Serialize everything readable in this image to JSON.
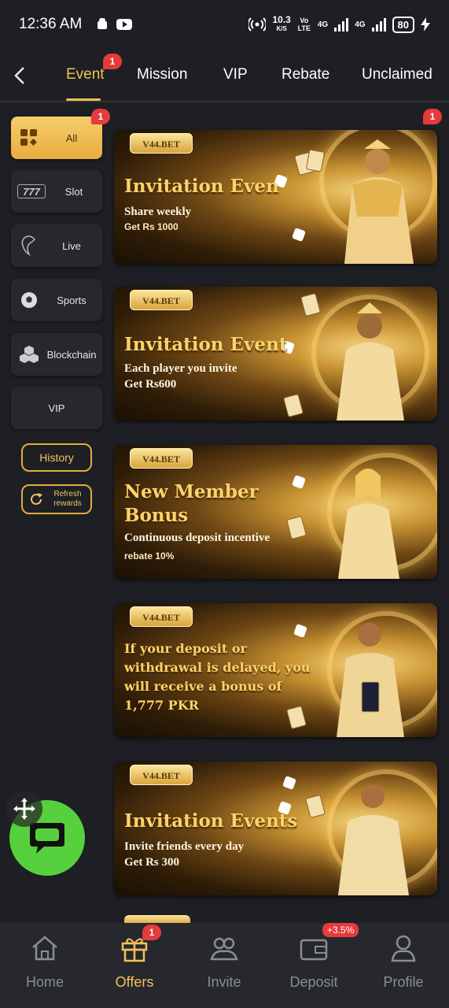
{
  "status_bar": {
    "time": "12:36 AM",
    "speed_value": "10.3",
    "speed_unit": "K/S",
    "volte": "Vo LTE",
    "net1": "4G",
    "net2": "4G",
    "battery": "80"
  },
  "topnav": {
    "tabs": [
      {
        "label": "Event",
        "badge": "1"
      },
      {
        "label": "Mission"
      },
      {
        "label": "VIP"
      },
      {
        "label": "Rebate"
      },
      {
        "label": "Unclaimed"
      }
    ]
  },
  "sidebar": {
    "categories": [
      {
        "label": "All",
        "badge": "1",
        "icon": "grid-icon"
      },
      {
        "label": "Slot",
        "icon": "slot-777-icon"
      },
      {
        "label": "Live",
        "icon": "live-dealer-icon"
      },
      {
        "label": "Sports",
        "icon": "soccer-ball-icon"
      },
      {
        "label": "Blockchain",
        "icon": "blockchain-icon"
      },
      {
        "label": "VIP"
      }
    ],
    "history_label": "History",
    "refresh_label_1": "Refresh",
    "refresh_label_2": "rewards"
  },
  "content": {
    "top_badge": "1",
    "banners": [
      {
        "tag": "V44.BET",
        "title": "Invitation Even",
        "line1": "Share weekly",
        "line2": "Get Rs 1000"
      },
      {
        "tag": "V44.BET",
        "title": "Invitation Event",
        "line1": "Each player you invite",
        "line2": "Get Rs600"
      },
      {
        "tag": "V44.BET",
        "title_a": "New Member",
        "title_b": "Bonus",
        "line1": "Continuous deposit incentive",
        "line2": "rebate 10%"
      },
      {
        "tag": "V44.BET",
        "text_a": "If your deposit or",
        "text_b": "withdrawal is delayed, you",
        "text_c": "will receive a bonus of",
        "text_d": "1,777 PKR"
      },
      {
        "tag": "V44.BET",
        "title": "Invitation Events",
        "line1": "Invite friends every day",
        "line2": "Get Rs 300"
      }
    ]
  },
  "bottom_nav": {
    "items": [
      {
        "label": "Home",
        "icon": "home-icon"
      },
      {
        "label": "Offers",
        "icon": "gift-icon",
        "badge": "1"
      },
      {
        "label": "Invite",
        "icon": "invite-icon"
      },
      {
        "label": "Deposit",
        "icon": "wallet-icon",
        "badge": "+3.5%"
      },
      {
        "label": "Profile",
        "icon": "profile-icon"
      }
    ]
  },
  "colors": {
    "accent": "#f2c057",
    "background": "#1d1f24",
    "badge": "#e53b3b",
    "chat_fab": "#56d13d"
  }
}
